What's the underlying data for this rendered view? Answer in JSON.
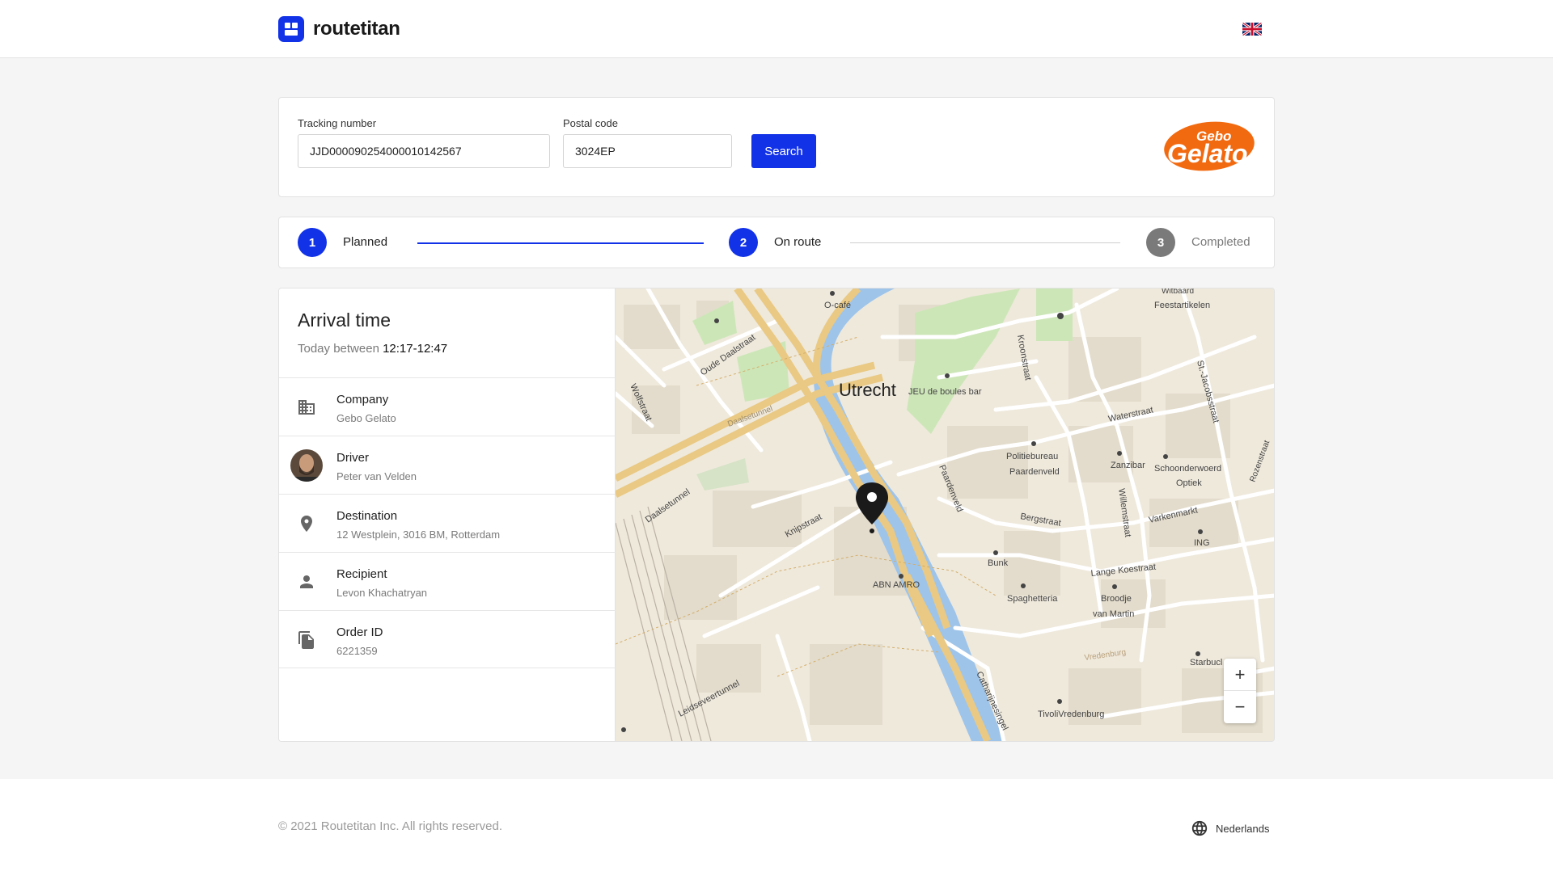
{
  "header": {
    "brand_name": "routetitan",
    "language_flag_icon": "uk-flag-icon"
  },
  "search": {
    "tracking_label": "Tracking number",
    "tracking_value": "JJD000090254000010142567",
    "postal_label": "Postal code",
    "postal_value": "3024EP",
    "search_button": "Search",
    "company_logo_text_top": "Gebo",
    "company_logo_text_bottom": "Gelato"
  },
  "stepper": {
    "steps": [
      {
        "number": "1",
        "label": "Planned",
        "state": "done"
      },
      {
        "number": "2",
        "label": "On route",
        "state": "active"
      },
      {
        "number": "3",
        "label": "Completed",
        "state": "pending"
      }
    ],
    "colors": {
      "active": "#1232e8",
      "pending": "#757575"
    }
  },
  "arrival": {
    "title": "Arrival time",
    "prefix": "Today between",
    "window": "12:17-12:47"
  },
  "details": [
    {
      "icon": "building-icon",
      "label": "Company",
      "value": "Gebo Gelato"
    },
    {
      "icon": "driver-avatar",
      "label": "Driver",
      "value": "Peter van Velden"
    },
    {
      "icon": "location-pin-icon",
      "label": "Destination",
      "value": "12 Westplein, 3016 BM, Rotterdam"
    },
    {
      "icon": "person-icon",
      "label": "Recipient",
      "value": "Levon Khachatryan"
    },
    {
      "icon": "document-icon",
      "label": "Order ID",
      "value": "6221359"
    }
  ],
  "map": {
    "city_label": "Utrecht",
    "labels": {
      "o_cafe": "O-café",
      "feestartikelen": "Feestartikelen",
      "witbaard": "Witbaard",
      "jeu_de_boules": "JEU de boules bar",
      "oude_daalstraat": "Oude Daalstraat",
      "wolfstraat": "Wolfstraat",
      "kroonstraat": "Kroonstraat",
      "waterstraat": "Waterstraat",
      "sint_jacobsstraat": "St.-Jacobsstraat",
      "daalsetunnel": "Daalsetunnel",
      "daalsetunnel_2": "Daalsetunnel",
      "politiebureau": "Politiebureau",
      "paardenveld": "Paardenveld",
      "paardenveld_street": "Paardenveld",
      "zanzibar": "Zanzibar",
      "schoonderwoerd": "Schoonderwoerd",
      "optiek": "Optiek",
      "knipstraat": "Knipstraat",
      "bergstraat": "Bergstraat",
      "varkenmarkt": "Varkenmarkt",
      "willemstraat": "Willemstraat",
      "ing": "ING",
      "bunk": "Bunk",
      "lange_koestraat": "Lange Koestraat",
      "abn_amro": "ABN AMRO",
      "spaghetteria": "Spaghetteria",
      "broodje": "Broodje",
      "van_martin": "van Martin",
      "starbucks": "Starbucl",
      "leidseveertunnel": "Leidseveertunnel",
      "catharijnesingel": "Catharijnesingel",
      "tivoli": "TivoliVredenburg",
      "rozenstraat": "Rozenstraat",
      "vredenburg": "Vredenburg"
    },
    "zoom_in": "+",
    "zoom_out": "−"
  },
  "footer": {
    "copyright": "© 2021 Routetitan Inc.  All rights reserved.",
    "language": "Nederlands",
    "language_icon": "globe-icon"
  }
}
